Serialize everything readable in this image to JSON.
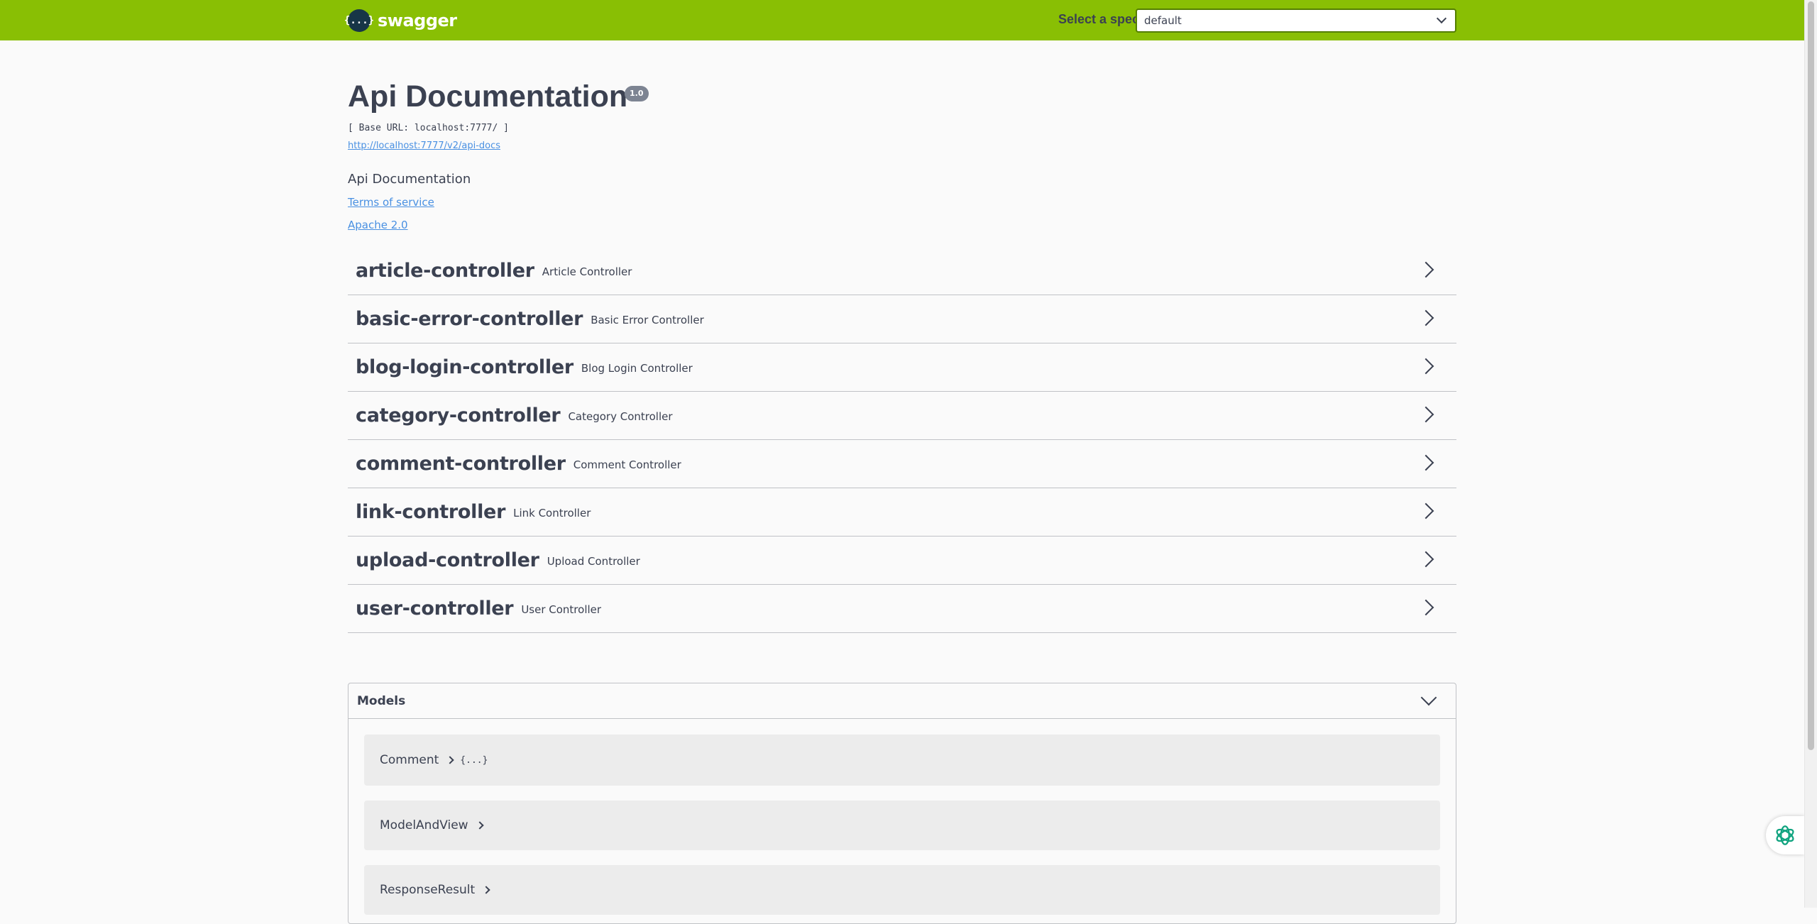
{
  "topbar": {
    "brand_icon": "{...}",
    "brand": "swagger",
    "spec_label": "Select a spec",
    "spec_value": "default"
  },
  "info": {
    "title": "Api Documentation",
    "version": "1.0",
    "base_url": "[ Base URL: localhost:7777/ ]",
    "docs_url": "http://localhost:7777/v2/api-docs",
    "description": "Api Documentation",
    "terms": "Terms of service",
    "license": "Apache 2.0"
  },
  "tags": [
    {
      "name": "article-controller",
      "desc": "Article Controller"
    },
    {
      "name": "basic-error-controller",
      "desc": "Basic Error Controller"
    },
    {
      "name": "blog-login-controller",
      "desc": "Blog Login Controller"
    },
    {
      "name": "category-controller",
      "desc": "Category Controller"
    },
    {
      "name": "comment-controller",
      "desc": "Comment Controller"
    },
    {
      "name": "link-controller",
      "desc": "Link Controller"
    },
    {
      "name": "upload-controller",
      "desc": "Upload Controller"
    },
    {
      "name": "user-controller",
      "desc": "User Controller"
    }
  ],
  "models": {
    "title": "Models",
    "items": [
      {
        "name": "Comment",
        "brace": "{...}"
      },
      {
        "name": "ModelAndView",
        "brace": ""
      },
      {
        "name": "ResponseResult",
        "brace": ""
      }
    ]
  },
  "colors": {
    "topbar": "#89bf04",
    "link": "#4990e2",
    "text": "#3b4151"
  }
}
